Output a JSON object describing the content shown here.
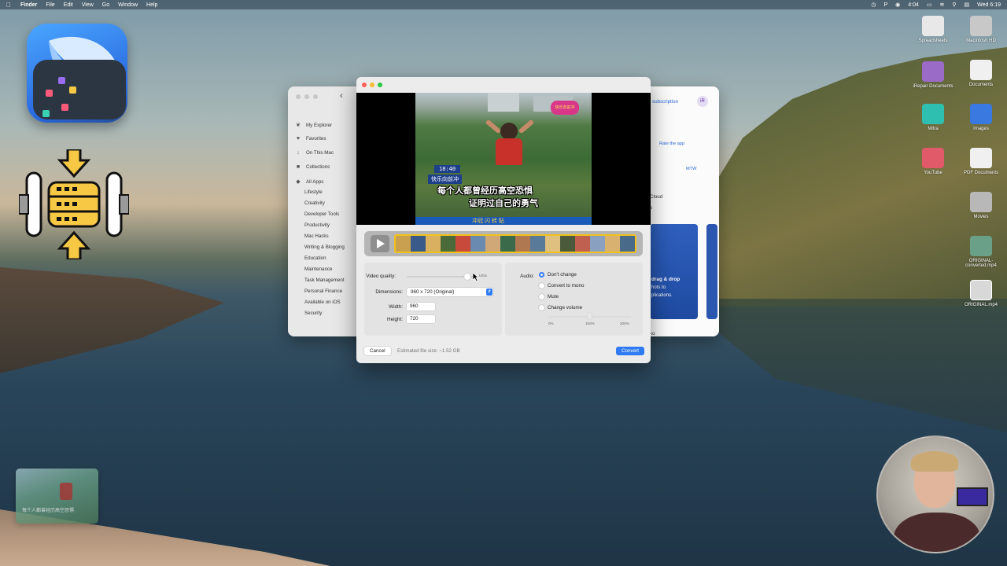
{
  "menubar": {
    "items": [
      "Finder",
      "File",
      "Edit",
      "View",
      "Go",
      "Window",
      "Help"
    ],
    "clock": "Wed 6:19",
    "battery": "4:04"
  },
  "desktop_icons": [
    {
      "label": "Spreadsheets",
      "color": "#e8e8e8"
    },
    {
      "label": "Macintosh HD",
      "color": "#c8c8c8"
    },
    {
      "label": "iRepair Documents",
      "color": "#9a6cc8"
    },
    {
      "label": "Documents",
      "color": "#f0f0f0"
    },
    {
      "label": "Mitra",
      "color": "#2fbfb0"
    },
    {
      "label": "Images",
      "color": "#3a7ae0"
    },
    {
      "label": "YouTube",
      "color": "#e05a6a"
    },
    {
      "label": "PDF Documents",
      "color": "#f0f0f0"
    },
    {
      "label": "Movies",
      "color": "#b8b8b8"
    },
    {
      "label": "ORIGINAL-converted.mp4",
      "color": "#6aa088"
    },
    {
      "label": "ORIGINAL.mp4",
      "color": "#d8d8d8"
    }
  ],
  "bg_window": {
    "sidebar": [
      {
        "label": "My Explorer",
        "icon": "leaf-icon"
      },
      {
        "label": "Favorites",
        "icon": "heart-icon"
      },
      {
        "label": "On This Mac",
        "icon": "download-icon"
      },
      {
        "label": "Collections",
        "icon": "folder-icon"
      },
      {
        "label": "All Apps",
        "icon": "diamond-icon"
      }
    ],
    "categories": [
      "Lifestyle",
      "Creativity",
      "Developer Tools",
      "Productivity",
      "Mac Hacks",
      "Writing & Blogging",
      "Education",
      "Maintenance",
      "Task Management",
      "Personal Finance",
      "Available on iOS",
      "Security"
    ],
    "right": {
      "subscription": "subscription",
      "rate": "Rate the app",
      "mtw": "MTW",
      "cloud": "Cloud",
      "s": "s",
      "card_title": "drag & drop",
      "card_line1": "hots to",
      "card_line2": "plications.",
      "bottom": "ko"
    }
  },
  "dialog": {
    "video": {
      "time": "18:40",
      "caption": "快乐向前冲",
      "subtitle1": "每个人都曾经历高空恐惧",
      "subtitle2": "证明过自己的勇气",
      "bottom_text": "冲冠  闪  转  贴",
      "logo_text": "快乐向前冲"
    },
    "video_quality_label": "Video quality:",
    "video_quality_value": "Ultra",
    "video_quality_level": 0.9,
    "dimensions_label": "Dimensions:",
    "dimensions_value": "960 x 720  (Original)",
    "width_label": "Width:",
    "width_value": "960",
    "height_label": "Height:",
    "height_value": "720",
    "audio_label": "Audio:",
    "audio_options": [
      "Don't change",
      "Convert to mono",
      "Mute",
      "Change volume"
    ],
    "audio_selected": 0,
    "volume_ticks": [
      "0%",
      "100%",
      "200%"
    ],
    "cancel": "Cancel",
    "estimate": "Estimated file size: ~1.52 GB",
    "convert": "Convert"
  },
  "pip": {
    "text": "每个人都曾经历高空恐惧"
  },
  "colors": {
    "accent": "#2f7bf5",
    "film_border": "#f2c21a",
    "close": "#ff5f57",
    "min": "#febc2e",
    "max": "#28c840"
  }
}
